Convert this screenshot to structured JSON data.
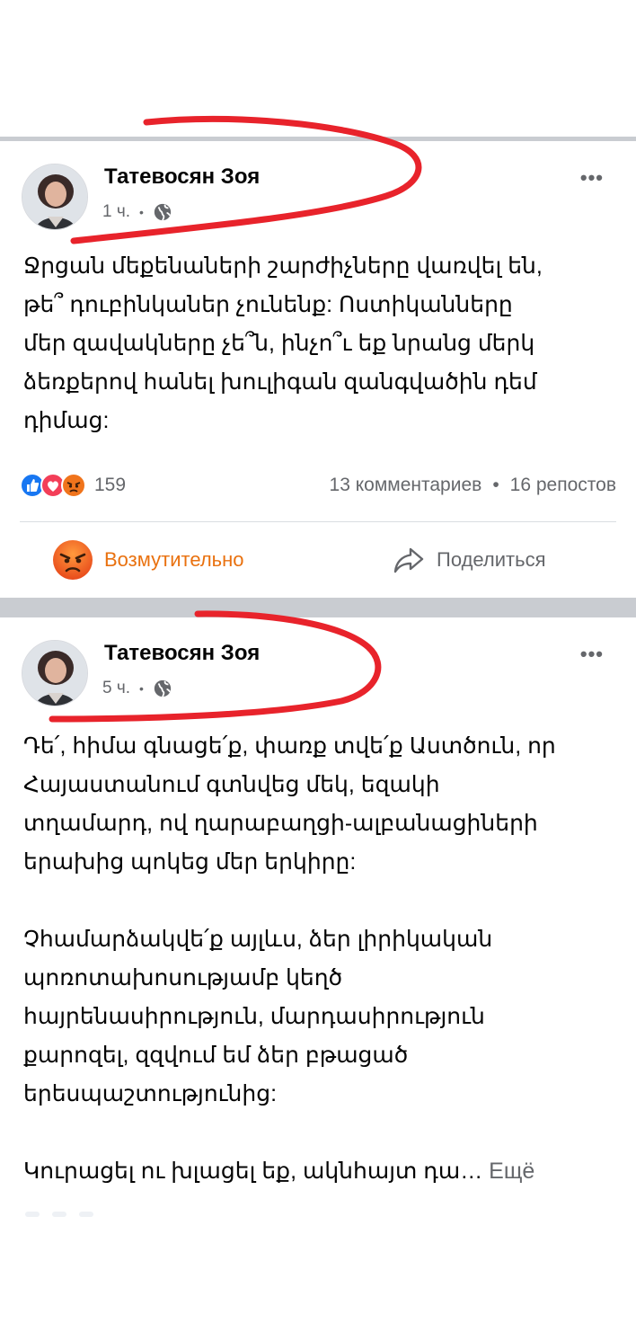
{
  "posts": [
    {
      "author": "Татевосян Зоя",
      "time": "1 ч.",
      "text": "Ջրցան մեքենաների շարժիչները վառվել են,\nթե՞ դուբինկաներ չունենք: Ոստիկանները\nմեր զավակները չե՞ն, ինչո՞ւ եք նրանց մերկ\nձեռքերով հանել խուլիգան զանգվածին դեմ\nդիմաց:",
      "reaction_count": "159",
      "comments": "13 комментариев",
      "reposts": "16 репостов",
      "action_react": "Возмутительно",
      "action_share": "Поделиться"
    },
    {
      "author": "Татевосян Зоя",
      "time": "5 ч.",
      "text": "Դե՛, հիմա գնացե՛ք, փառք տվե՛ք Աստծուն, որ\nՀայաստանում գտնվեց մեկ, եզակի\nտղամարդ, ով ղարաբաղցի-ալբանացիների\nերախից պոկեց մեր երկիրը:\n\nՉհամարձակվե՛ք այլևս, ձեր լիրիկական\nպոռոտախոսությամբ կեղծ\nհայրենասիրություն, մարդասիրություն\nքարոզել, զզվում եմ ձեր բթացած\nերեսպաշտությունից:\n\nԿուրացել ու խլացել եք, ակնհայտ դա…",
      "more_label": "Ещё"
    }
  ],
  "colors": {
    "annotation": "#e8232b",
    "angry": "#f0741c",
    "like": "#1877f2",
    "love": "#f33e58",
    "separator": "#c9ccd1"
  },
  "icons": {
    "globe": "globe-icon",
    "more": "more-options-icon",
    "like": "like-reaction-icon",
    "love": "love-reaction-icon",
    "angry": "angry-reaction-icon",
    "share": "share-arrow-icon"
  }
}
